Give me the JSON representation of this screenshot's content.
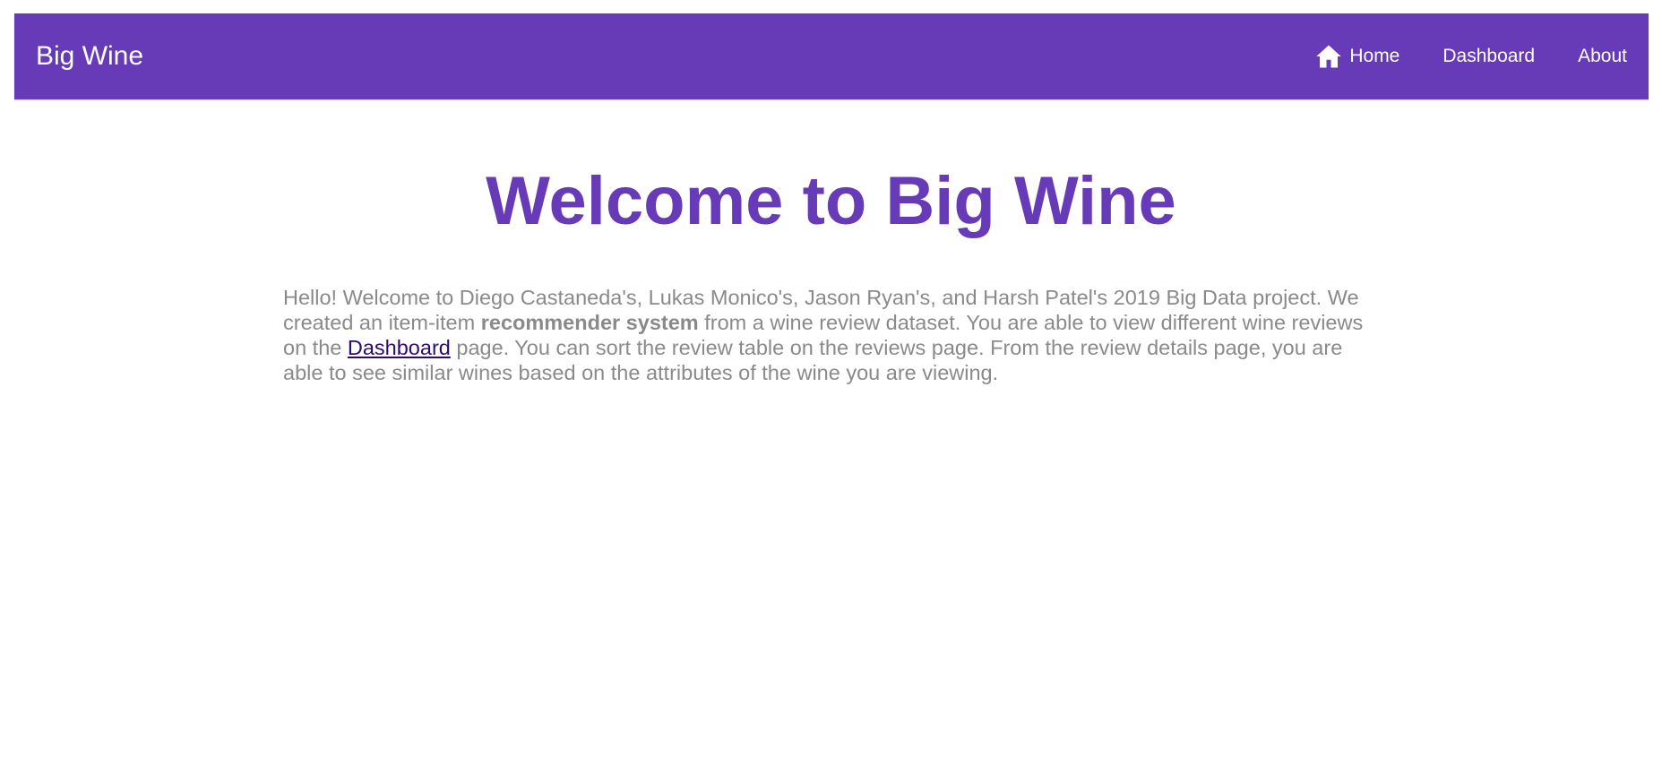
{
  "app": {
    "brand": "Big Wine",
    "accent_color": "#673ab7"
  },
  "nav": {
    "items": [
      {
        "label": "Home",
        "icon": "home-icon"
      },
      {
        "label": "Dashboard"
      },
      {
        "label": "About"
      }
    ]
  },
  "main": {
    "title": "Welcome to Big Wine",
    "intro": {
      "part1": "Hello! Welcome to Diego Castaneda's, Lukas Monico's, Jason Ryan's, and Harsh Patel's 2019 Big Data project. We created an item-item ",
      "bold": "recommender system",
      "part2": " from a wine review dataset. You are able to view different wine reviews on the ",
      "link": "Dashboard",
      "part3": " page. You can sort the review table on the reviews page. From the review details page, you are able to see similar wines based on the attributes of the wine you are viewing."
    }
  }
}
